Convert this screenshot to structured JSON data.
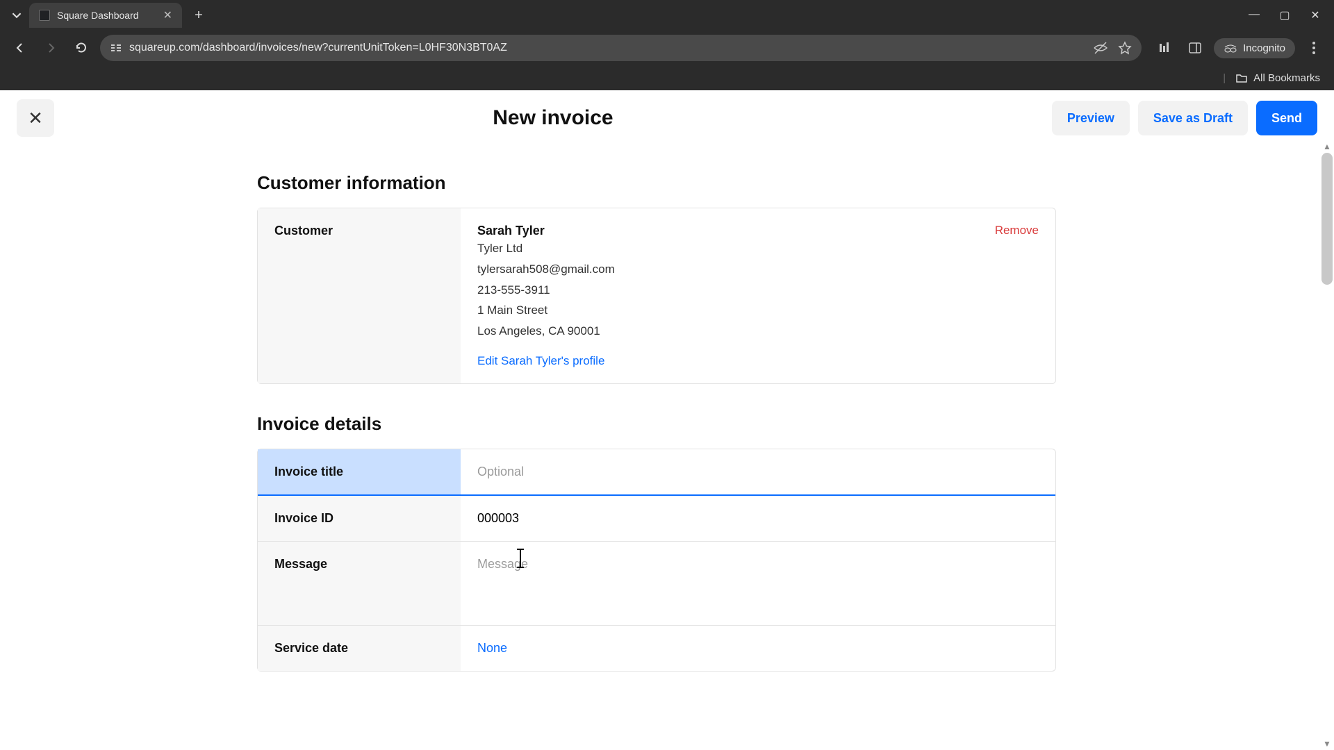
{
  "browser": {
    "tab_title": "Square Dashboard",
    "url": "squareup.com/dashboard/invoices/new?currentUnitToken=L0HF30N3BT0AZ",
    "incognito_label": "Incognito",
    "all_bookmarks": "All Bookmarks"
  },
  "header": {
    "title": "New invoice",
    "preview": "Preview",
    "save_draft": "Save as Draft",
    "send": "Send"
  },
  "sections": {
    "customer_info_title": "Customer information",
    "invoice_details_title": "Invoice details"
  },
  "customer": {
    "label": "Customer",
    "name": "Sarah Tyler",
    "company": "Tyler Ltd",
    "email": "tylersarah508@gmail.com",
    "phone": "213-555-3911",
    "address1": "1 Main Street",
    "address2": "Los Angeles, CA 90001",
    "edit_link": "Edit Sarah Tyler's profile",
    "remove": "Remove"
  },
  "invoice": {
    "title_label": "Invoice title",
    "title_placeholder": "Optional",
    "title_value": "",
    "id_label": "Invoice ID",
    "id_value": "000003",
    "message_label": "Message",
    "message_placeholder": "Message",
    "message_value": "",
    "service_date_label": "Service date",
    "service_date_value": "None"
  }
}
